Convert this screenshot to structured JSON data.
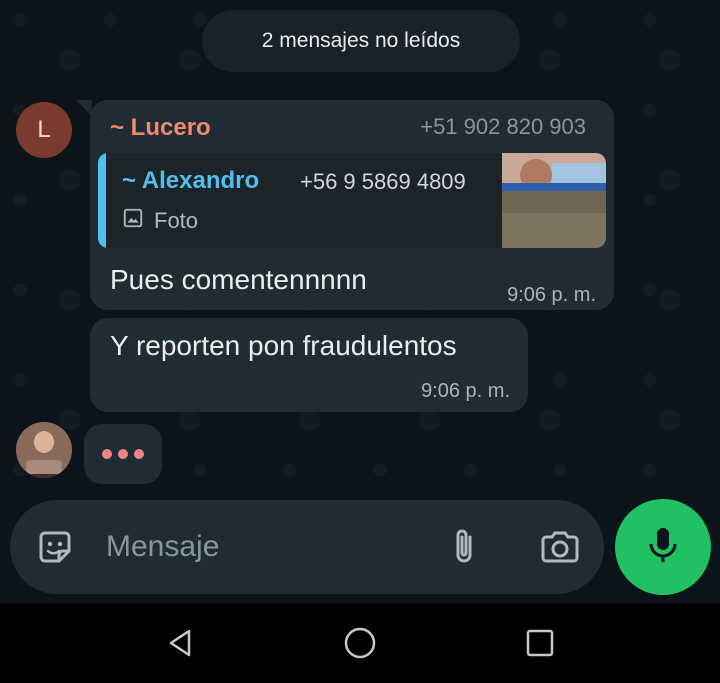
{
  "unread_banner": "2 mensajes no leídos",
  "contact_avatar_initial": "L",
  "message1": {
    "sender_name": "~ Lucero",
    "sender_phone": "+51 902 820 903",
    "quoted": {
      "name": "~ Alexandro",
      "phone": "+56 9 5869 4809",
      "media_label": "Foto",
      "media_icon": "image-icon"
    },
    "text": "Pues comentennnnn",
    "time": "9:06 p. m."
  },
  "message2": {
    "text": "Y reporten pon fraudulentos",
    "time": "9:06 p. m."
  },
  "typing_indicator": "•••",
  "composer": {
    "placeholder": "Mensaje",
    "sticker_icon": "sticker-icon",
    "attach_icon": "paperclip-icon",
    "camera_icon": "camera-icon",
    "mic_icon": "mic-icon"
  },
  "nav": {
    "back_icon": "back-triangle-icon",
    "home_icon": "home-circle-icon",
    "recents_icon": "recents-square-icon"
  },
  "colors": {
    "background": "#0b141a",
    "bubble": "#202c33",
    "accent_green": "#21c063",
    "sender_name": "#f1896f",
    "quote_accent": "#53bdeb"
  }
}
